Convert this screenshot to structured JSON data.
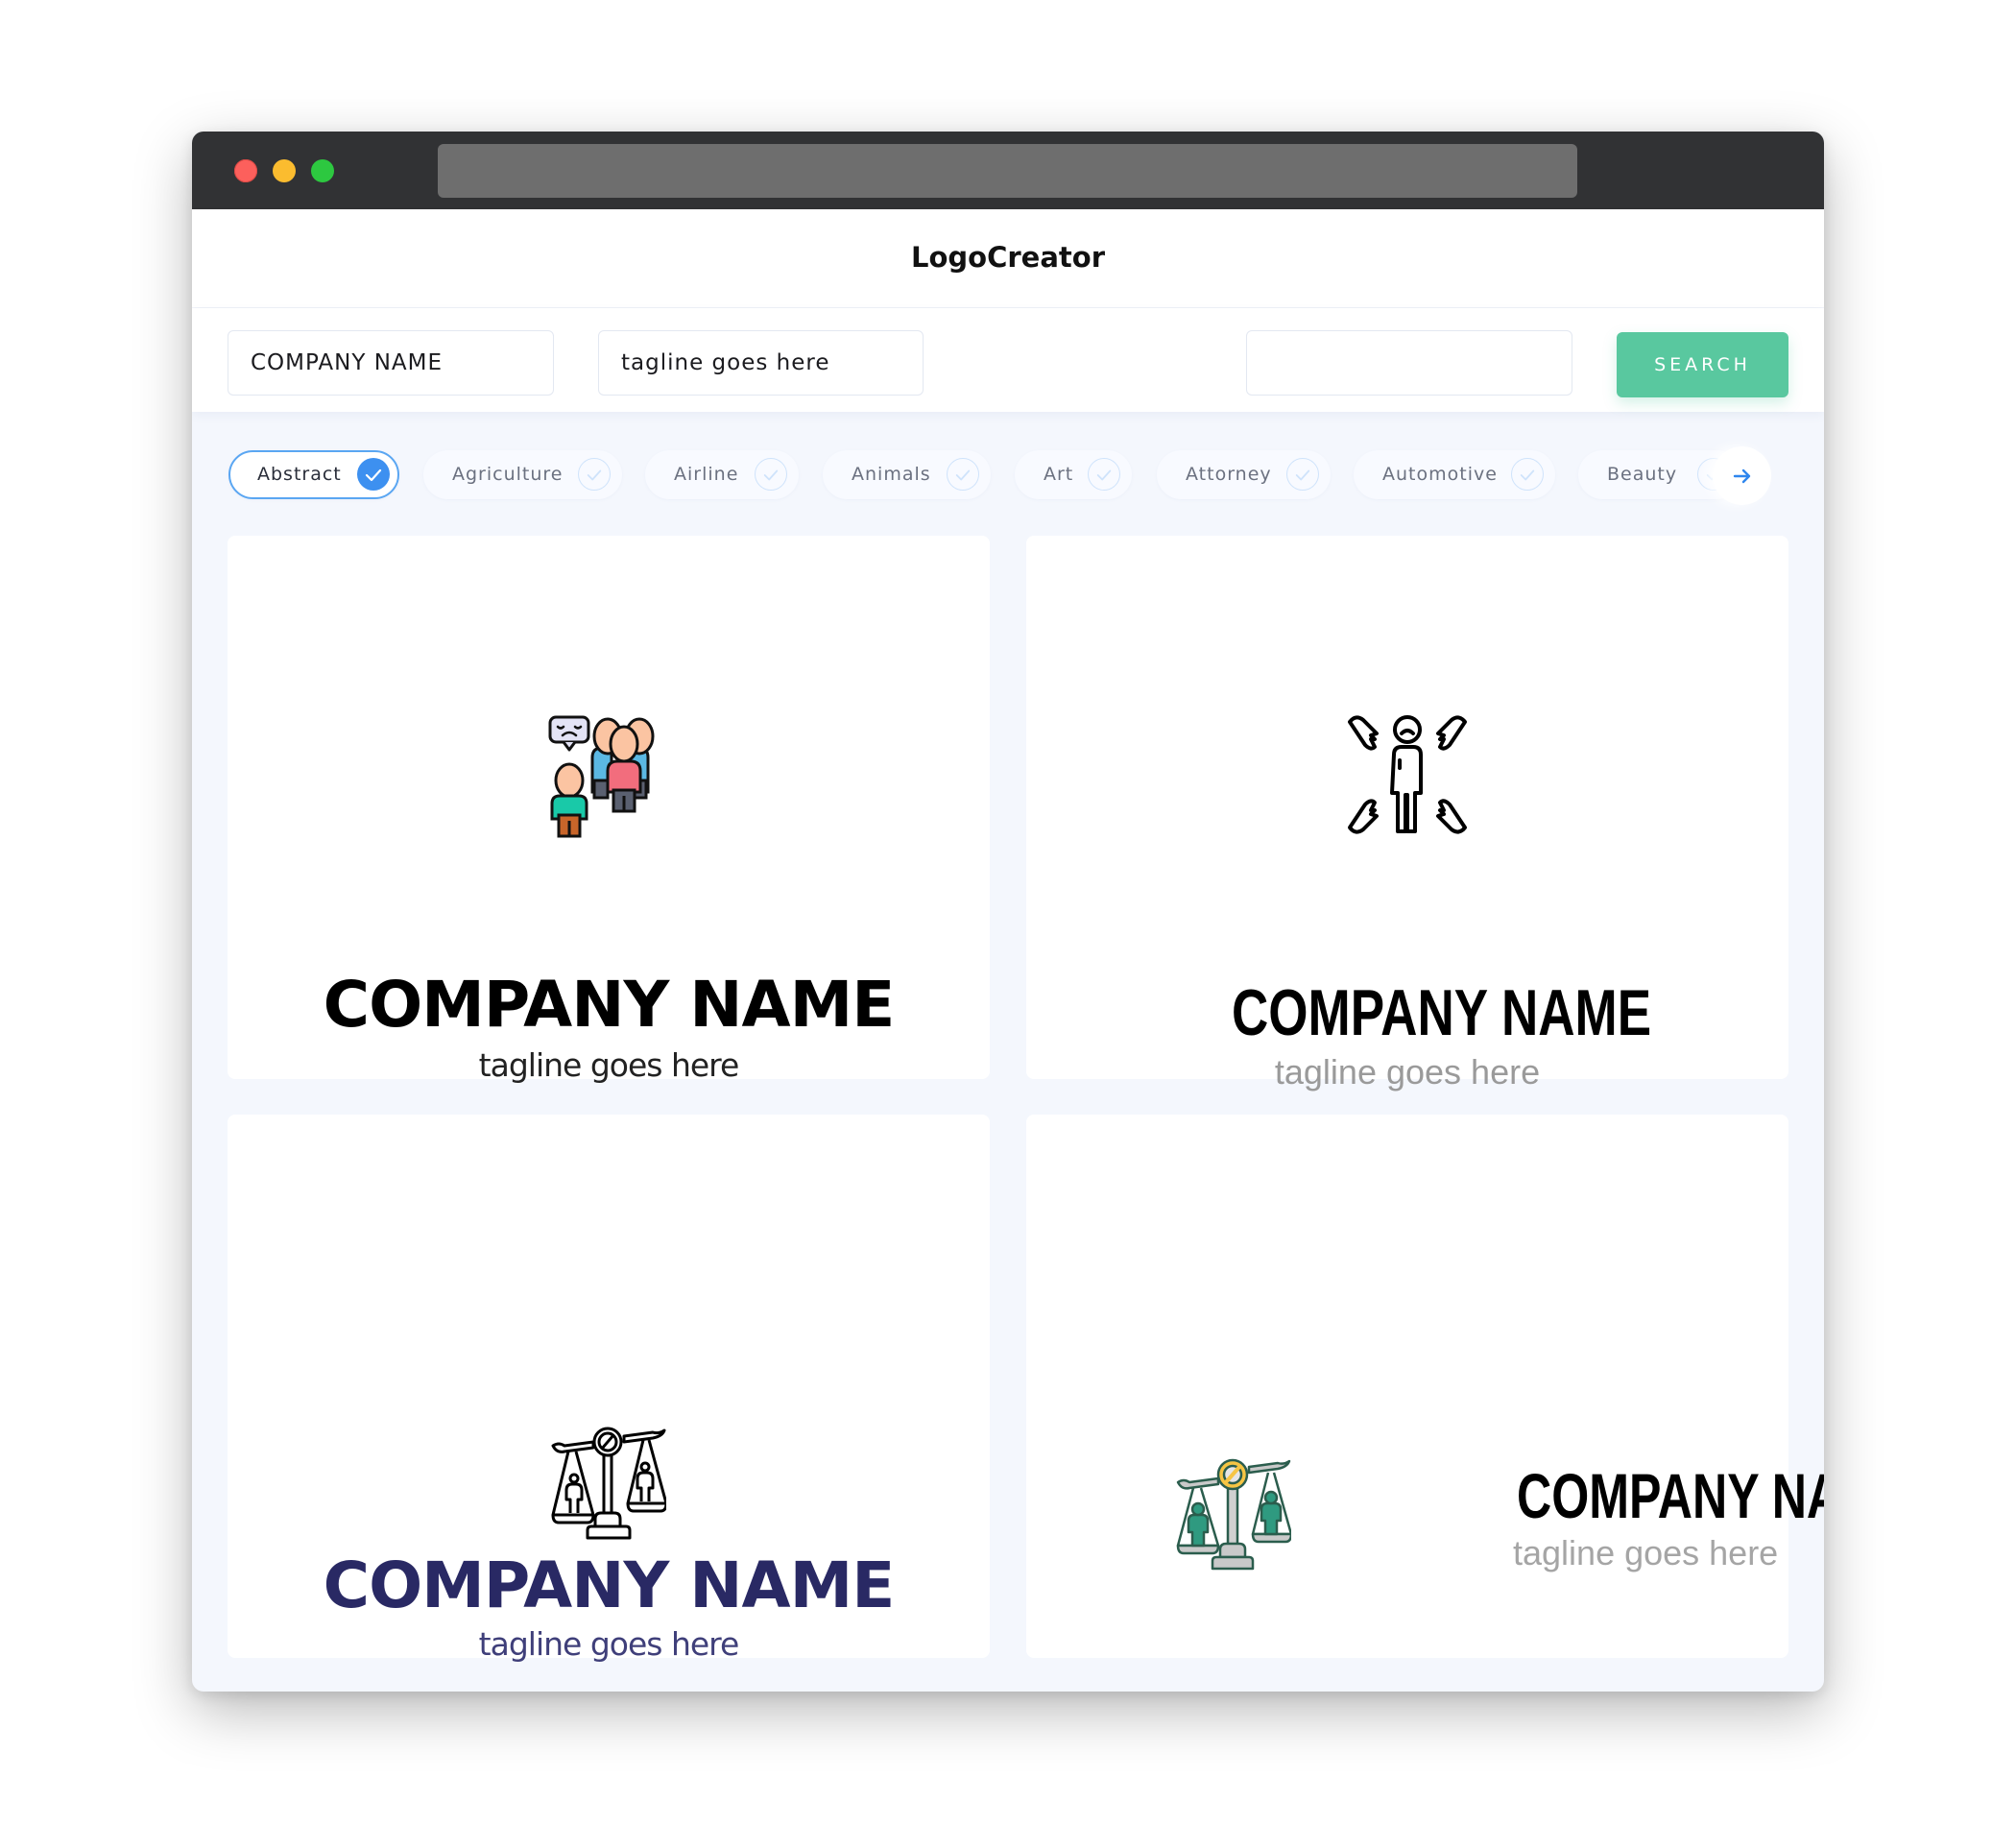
{
  "window": {
    "traffic_lights": [
      "close",
      "minimize",
      "maximize"
    ]
  },
  "header": {
    "brand": "LogoCreator"
  },
  "search": {
    "company_name_value": "COMPANY NAME",
    "tagline_value": "tagline goes here",
    "keyword_value": "",
    "button_label": "SEARCH",
    "accent_color": "#59c89f"
  },
  "categories": {
    "items": [
      {
        "label": "Abstract",
        "selected": true
      },
      {
        "label": "Agriculture",
        "selected": false
      },
      {
        "label": "Airline",
        "selected": false
      },
      {
        "label": "Animals",
        "selected": false
      },
      {
        "label": "Art",
        "selected": false
      },
      {
        "label": "Attorney",
        "selected": false
      },
      {
        "label": "Automotive",
        "selected": false
      },
      {
        "label": "Beauty",
        "selected": false
      }
    ],
    "next_icon": "arrow-right-icon",
    "selected_color": "#3d90f0"
  },
  "logos": [
    {
      "icon": "people-group-speech-icon",
      "company_name": "COMPANY NAME",
      "tagline": "tagline goes here",
      "name_color": "#000000",
      "tagline_color": "#222222"
    },
    {
      "icon": "person-broken-hearts-icon",
      "company_name": "COMPANY NAME",
      "tagline": "tagline goes here",
      "name_color": "#000000",
      "tagline_color": "#9a9a9a"
    },
    {
      "icon": "scales-discrimination-outline-icon",
      "company_name": "COMPANY NAME",
      "tagline": "tagline goes here",
      "name_color": "#292964",
      "tagline_color": "#3f3f7a"
    },
    {
      "icon": "scales-discrimination-color-icon",
      "company_name": "COMPANY NAME",
      "tagline": "tagline goes here",
      "name_color": "#000000",
      "tagline_color": "#a5a5a5"
    }
  ]
}
